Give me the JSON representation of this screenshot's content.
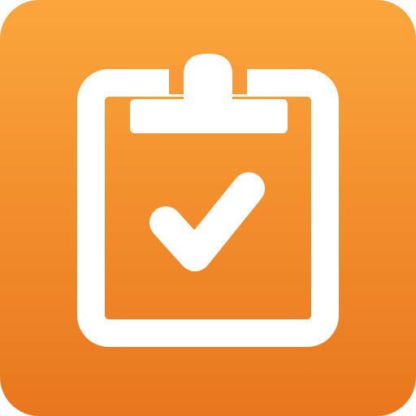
{
  "icon": {
    "name": "clipboard-check-icon",
    "colors": {
      "gradient_top": "#FBA63C",
      "gradient_bottom": "#E8761E",
      "glyph": "#FFFFFF"
    }
  }
}
